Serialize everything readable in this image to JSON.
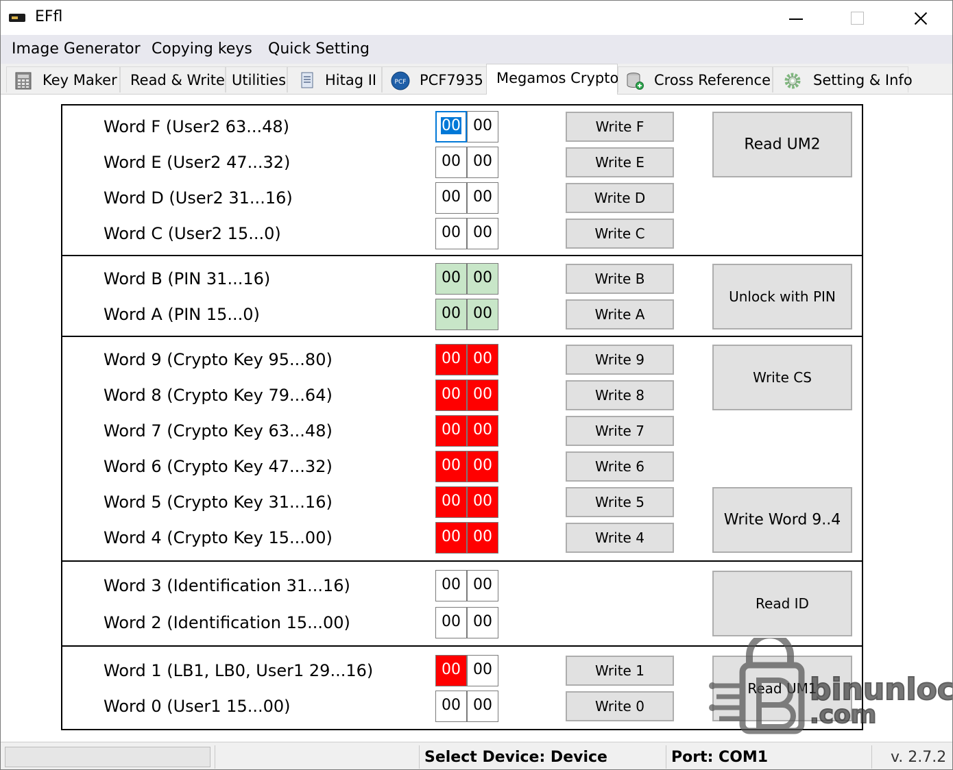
{
  "window": {
    "title": "EFfl"
  },
  "menu": [
    "Image Generator",
    "Copying keys",
    "Quick Setting"
  ],
  "tabs": [
    {
      "label": "Key Maker",
      "icon": "calculator-icon"
    },
    {
      "label": "Read & Write"
    },
    {
      "label": "Utilities"
    },
    {
      "label": "Hitag II",
      "icon": "document-icon"
    },
    {
      "label": "PCF7935",
      "icon": "pcf-badge-icon"
    },
    {
      "label": "Megamos Crypto",
      "active": true
    },
    {
      "label": "Cross Reference",
      "icon": "database-icon"
    },
    {
      "label": "Setting & Info",
      "icon": "gear-icon"
    }
  ],
  "rows": [
    {
      "label": "Word F (User2 63...48)",
      "hi": "00",
      "lo": "00",
      "color": "white",
      "write": "Write F"
    },
    {
      "label": "Word E (User2 47...32)",
      "hi": "00",
      "lo": "00",
      "color": "white",
      "write": "Write E"
    },
    {
      "label": "Word D (User2 31...16)",
      "hi": "00",
      "lo": "00",
      "color": "white",
      "write": "Write D"
    },
    {
      "label": "Word C (User2 15...0)",
      "hi": "00",
      "lo": "00",
      "color": "white",
      "write": "Write C"
    },
    {
      "label": "Word B (PIN 31...16)",
      "hi": "00",
      "lo": "00",
      "color": "green",
      "write": "Write B"
    },
    {
      "label": "Word A (PIN 15...0)",
      "hi": "00",
      "lo": "00",
      "color": "green",
      "write": "Write A"
    },
    {
      "label": "Word 9 (Crypto Key 95...80)",
      "hi": "00",
      "lo": "00",
      "color": "red",
      "write": "Write 9"
    },
    {
      "label": "Word 8 (Crypto Key 79...64)",
      "hi": "00",
      "lo": "00",
      "color": "red",
      "write": "Write 8"
    },
    {
      "label": "Word 7 (Crypto Key 63...48)",
      "hi": "00",
      "lo": "00",
      "color": "red",
      "write": "Write 7"
    },
    {
      "label": "Word 6 (Crypto Key 47...32)",
      "hi": "00",
      "lo": "00",
      "color": "red",
      "write": "Write 6"
    },
    {
      "label": "Word 5 (Crypto Key 31...16)",
      "hi": "00",
      "lo": "00",
      "color": "red",
      "write": "Write 5"
    },
    {
      "label": "Word 4 (Crypto Key 15...00)",
      "hi": "00",
      "lo": "00",
      "color": "red",
      "write": "Write 4"
    },
    {
      "label": "Word 3 (Identification 31...16)",
      "hi": "00",
      "lo": "00",
      "color": "white",
      "write": ""
    },
    {
      "label": "Word 2 (Identification 15...00)",
      "hi": "00",
      "lo": "00",
      "color": "white",
      "write": ""
    },
    {
      "label": "Word 1 (LB1, LB0, User1 29...16)",
      "hi": "00",
      "lo": "00",
      "color": "white",
      "hi_color": "red",
      "write": "Write 1"
    },
    {
      "label": "Word 0 (User1 15...00)",
      "hi": "00",
      "lo": "00",
      "color": "white",
      "write": "Write 0"
    }
  ],
  "action_buttons": [
    "Read UM2",
    "Unlock with PIN",
    "Write CS",
    "Write Word 9..4",
    "Read ID",
    "Read UM1"
  ],
  "status": {
    "device": "Select Device:  Device",
    "port": "Port:  COM1",
    "version": "v. 2.7.2"
  },
  "watermark": {
    "line1": "binunlock",
    "line2": ".com"
  },
  "colors": {
    "red": "#ff0000",
    "green": "#c8e6c8",
    "selection": "#0078d7"
  }
}
